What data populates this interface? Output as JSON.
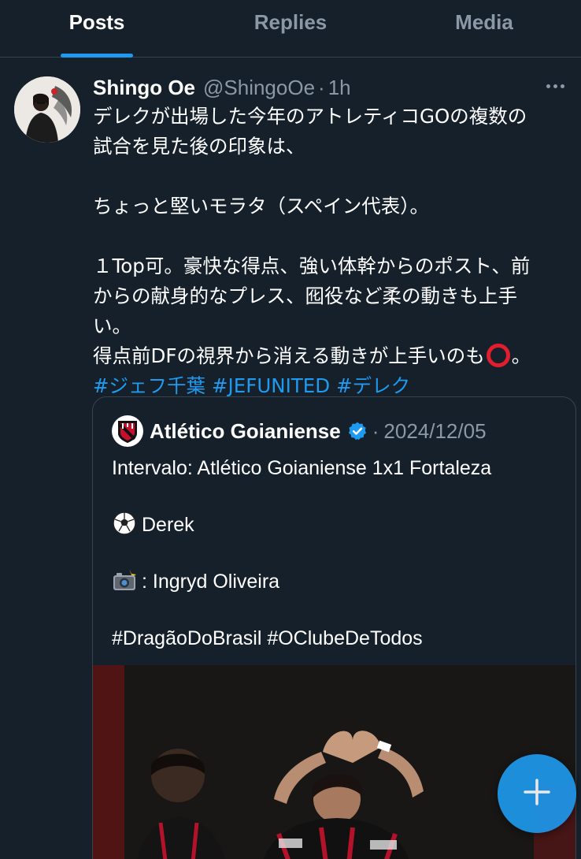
{
  "tabs": [
    {
      "label": "Posts",
      "active": true
    },
    {
      "label": "Replies",
      "active": false
    },
    {
      "label": "Media",
      "active": false
    }
  ],
  "post": {
    "author_name": "Shingo Oe",
    "handle": "@ShingoOe",
    "separator": "·",
    "time": "1h",
    "lines": [
      "デレクが出場した今年のアトレティコGOの複数の",
      "試合を見た後の印象は、",
      "",
      "ちょっと堅いモラタ（スペイン代表）。",
      "",
      "１Top可。豪快な得点、強い体幹からのポスト、前",
      "からの献身的なプレス、囮役など柔の動きも上手",
      "い。",
      "得点前DFの視界から消える動きが上手いのも"
    ],
    "last_line_suffix": "。",
    "hashtags": [
      "#ジェフ千葉",
      "#JEFUNITED",
      "#デレク"
    ]
  },
  "quote": {
    "author_name": "Atlético Goianiense",
    "separator": "·",
    "date": "2024/12/05",
    "line1": "Intervalo: Atlético Goianiense 1x1 Fortaleza",
    "line2": "Derek",
    "line3": ": Ingryd Oliveira",
    "line4": "#DragãoDoBrasil #OClubeDeTodos"
  },
  "icons": {
    "more": "more-icon",
    "verified": "verified-badge-icon",
    "soccer": "soccer-ball-icon",
    "camera": "camera-flash-icon",
    "compose": "plus-icon"
  },
  "colors": {
    "background": "#15202b",
    "accent": "#1d9bf0",
    "muted": "#8b98a5",
    "border": "#38444d",
    "red_circle": "#e11d2e"
  }
}
